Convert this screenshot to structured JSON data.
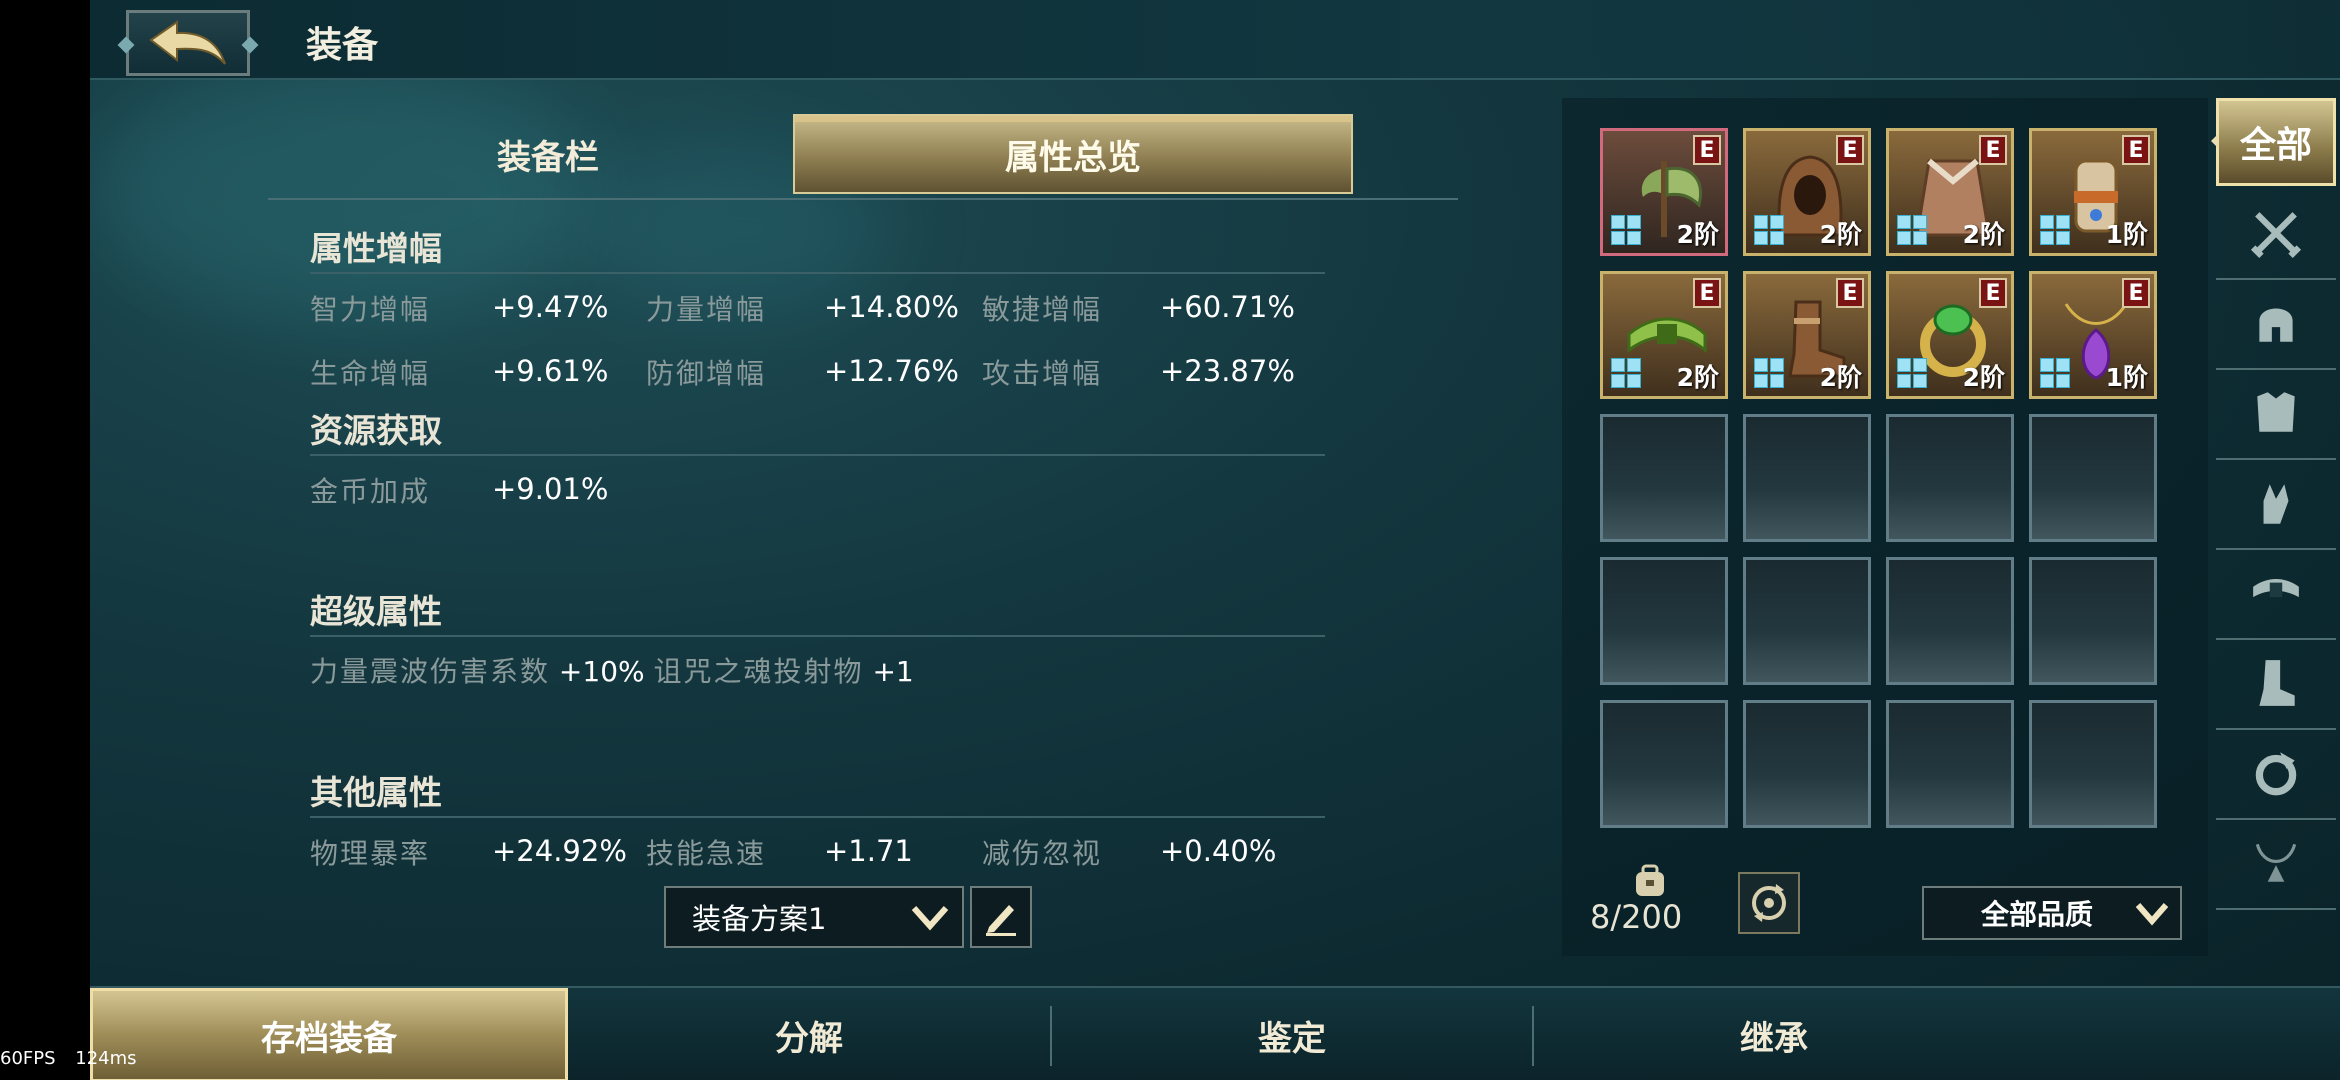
{
  "header": {
    "title": "装备"
  },
  "tabs": [
    {
      "label": "装备栏"
    },
    {
      "label": "属性总览"
    }
  ],
  "sections": {
    "amplify": {
      "title": "属性增幅",
      "rows": [
        [
          {
            "label": "智力增幅",
            "value": "+9.47%"
          },
          {
            "label": "力量增幅",
            "value": "+14.80%"
          },
          {
            "label": "敏捷增幅",
            "value": "+60.71%"
          }
        ],
        [
          {
            "label": "生命增幅",
            "value": "+9.61%"
          },
          {
            "label": "防御增幅",
            "value": "+12.76%"
          },
          {
            "label": "攻击增幅",
            "value": "+23.87%"
          }
        ]
      ]
    },
    "resource": {
      "title": "资源获取",
      "items": [
        {
          "label": "金币加成",
          "value": "+9.01%"
        }
      ]
    },
    "super": {
      "title": "超级属性",
      "items": [
        {
          "label": "力量震波伤害系数",
          "value": "+10%"
        },
        {
          "label": "诅咒之魂投射物",
          "value": "+1"
        }
      ]
    },
    "other": {
      "title": "其他属性",
      "items": [
        {
          "label": "物理暴率",
          "value": "+24.92%"
        },
        {
          "label": "技能急速",
          "value": "+1.71"
        },
        {
          "label": "减伤忽视",
          "value": "+0.40%"
        }
      ]
    }
  },
  "plan": {
    "selected": "装备方案1"
  },
  "inventory": {
    "items": [
      {
        "icon": "axe-icon",
        "grade": "E",
        "tier": "2阶",
        "frame": "red"
      },
      {
        "icon": "hood-icon",
        "grade": "E",
        "tier": "2阶",
        "frame": "gold"
      },
      {
        "icon": "cloak-icon",
        "grade": "E",
        "tier": "2阶",
        "frame": "gold"
      },
      {
        "icon": "gauntlet-icon",
        "grade": "E",
        "tier": "1阶",
        "frame": "gold"
      },
      {
        "icon": "belt-icon",
        "grade": "E",
        "tier": "2阶",
        "frame": "gold"
      },
      {
        "icon": "boot-icon",
        "grade": "E",
        "tier": "2阶",
        "frame": "gold"
      },
      {
        "icon": "ring-icon",
        "grade": "E",
        "tier": "2阶",
        "frame": "gold"
      },
      {
        "icon": "amulet-icon",
        "grade": "E",
        "tier": "1阶",
        "frame": "gold"
      }
    ],
    "empty_slots": 12,
    "count": "8/200",
    "quality_filter": "全部品质"
  },
  "categories": {
    "all_label": "全部",
    "icons": [
      "crossed-swords-icon",
      "helmet-icon",
      "armor-icon",
      "gauntlet-icon",
      "belt-icon",
      "boot-icon",
      "ring-icon",
      "necklace-icon"
    ]
  },
  "bottom_nav": [
    {
      "label": "存档装备"
    },
    {
      "label": "分解"
    },
    {
      "label": "鉴定"
    },
    {
      "label": "继承"
    }
  ],
  "debug": {
    "fps": "60FPS",
    "latency": "124ms"
  },
  "colors": {
    "gold_accent": "#c9b36c",
    "background": "#143840",
    "rare_frame": "#d16a7c"
  }
}
